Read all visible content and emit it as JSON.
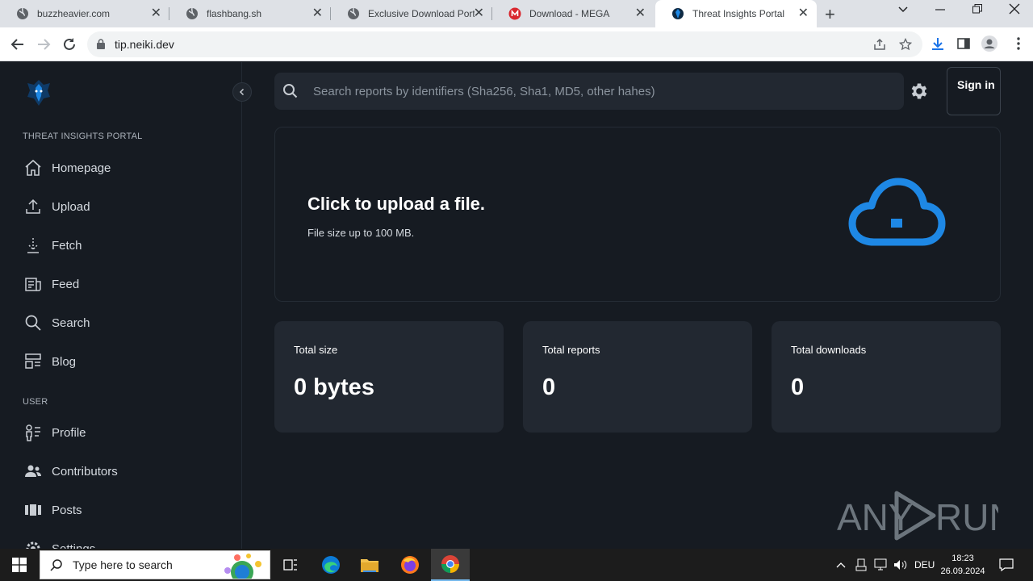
{
  "browser": {
    "tabs": [
      {
        "title": "buzzheavier.com",
        "icon": "globe-icon"
      },
      {
        "title": "flashbang.sh",
        "icon": "globe-icon"
      },
      {
        "title": "Exclusive Download Port",
        "icon": "globe-icon"
      },
      {
        "title": "Download - MEGA",
        "icon": "mega-icon"
      },
      {
        "title": "Threat Insights Portal",
        "icon": "portal-icon",
        "active": true
      }
    ],
    "url": "tip.neiki.dev"
  },
  "sidebar": {
    "section_portal": "THREAT INSIGHTS PORTAL",
    "items_portal": [
      {
        "label": "Homepage",
        "icon": "home-icon"
      },
      {
        "label": "Upload",
        "icon": "upload-icon"
      },
      {
        "label": "Fetch",
        "icon": "fetch-icon"
      },
      {
        "label": "Feed",
        "icon": "feed-icon"
      },
      {
        "label": "Search",
        "icon": "search-icon"
      },
      {
        "label": "Blog",
        "icon": "blog-icon"
      }
    ],
    "section_user": "USER",
    "items_user": [
      {
        "label": "Profile",
        "icon": "profile-icon"
      },
      {
        "label": "Contributors",
        "icon": "contributors-icon"
      },
      {
        "label": "Posts",
        "icon": "posts-icon"
      },
      {
        "label": "Settings",
        "icon": "settings-icon"
      }
    ]
  },
  "header": {
    "search_placeholder": "Search reports by identifiers (Sha256, Sha1, MD5, other hahes)",
    "signin_label": "Sign in"
  },
  "upload": {
    "title": "Click to upload a file.",
    "subtitle": "File size up to 100 MB."
  },
  "stats": [
    {
      "label": "Total size",
      "value": "0 bytes"
    },
    {
      "label": "Total reports",
      "value": "0"
    },
    {
      "label": "Total downloads",
      "value": "0"
    }
  ],
  "watermark": "ANY RUN",
  "taskbar": {
    "search_placeholder": "Type here to search",
    "language": "DEU",
    "time": "18:23",
    "date": "26.09.2024"
  },
  "colors": {
    "accent": "#1e88e5",
    "background": "#161b22",
    "card": "#222831"
  }
}
